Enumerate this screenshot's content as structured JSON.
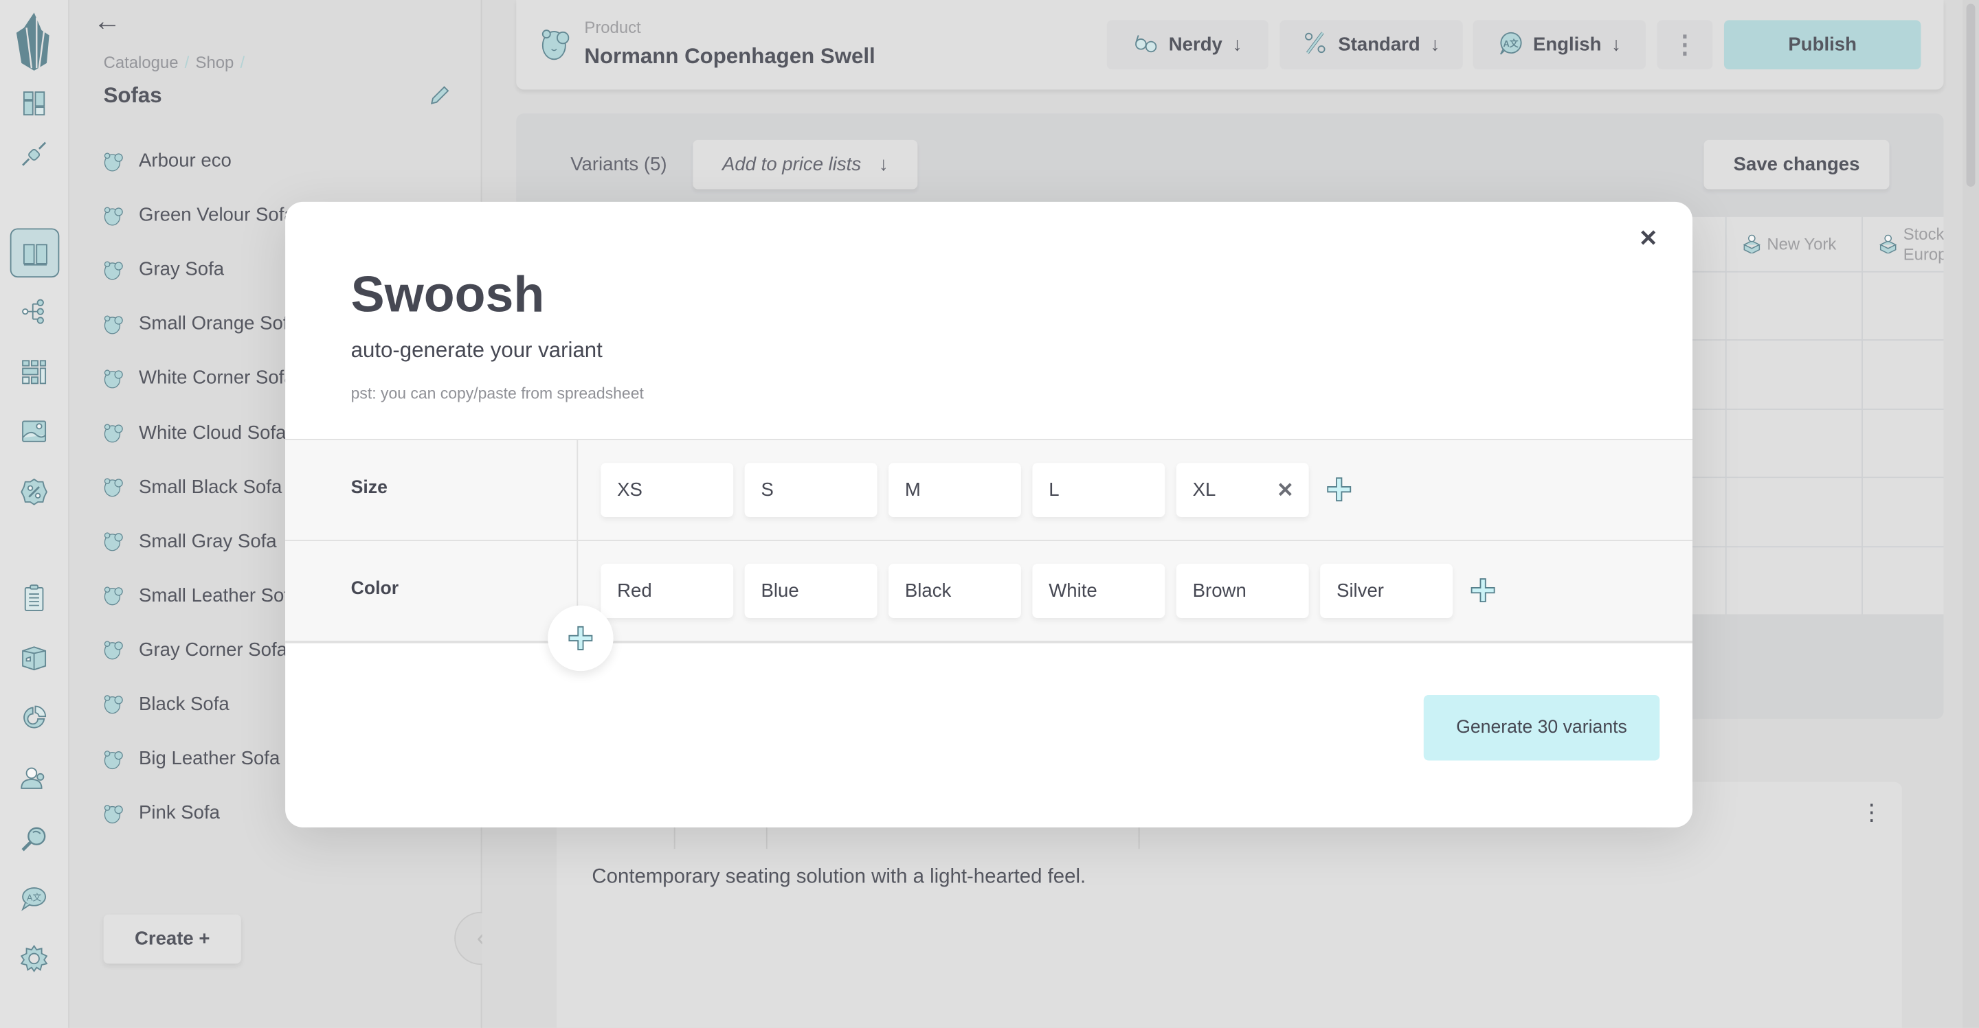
{
  "rail": {
    "logo": "logo-icon",
    "items": [
      {
        "icon": "dashboard-icon",
        "active": false
      },
      {
        "icon": "plug-icon",
        "active": false
      },
      {
        "icon": "book-icon",
        "active": true
      },
      {
        "icon": "tree-icon",
        "active": false
      },
      {
        "icon": "grid-icon",
        "active": false
      },
      {
        "icon": "image-icon",
        "active": false
      },
      {
        "icon": "discount-icon",
        "active": false
      },
      {
        "icon": "clipboard-icon",
        "active": false
      },
      {
        "icon": "box-icon",
        "active": false
      },
      {
        "icon": "pie-chart-icon",
        "active": false
      },
      {
        "icon": "users-icon",
        "active": false
      },
      {
        "icon": "search-icon",
        "active": false
      },
      {
        "icon": "translate-icon",
        "active": false
      },
      {
        "icon": "settings-icon",
        "active": false
      }
    ]
  },
  "sidebar": {
    "breadcrumb": [
      "Catalogue",
      "Shop"
    ],
    "breadcrumb_sep": "/",
    "title": "Sofas",
    "items": [
      "Arbour eco",
      "Green Velour Sofa",
      "Gray Sofa",
      "Small Orange Sofa",
      "White Corner Sofa",
      "White Cloud Sofa",
      "Small Black Sofa",
      "Small Gray Sofa",
      "Small Leather Sofa",
      "Gray Corner Sofa",
      "Black Sofa",
      "Big Leather Sofa",
      "Pink Sofa"
    ],
    "create_label": "Create +",
    "collapse_glyph": "‹",
    "back_glyph": "←"
  },
  "header": {
    "label": "Product",
    "name": "Normann Copenhagen Swell",
    "buttons": [
      {
        "label": "Nerdy",
        "icon": "glasses-icon",
        "arrow": "↓"
      },
      {
        "label": "Standard",
        "icon": "percent-icon",
        "arrow": "↓"
      },
      {
        "label": "English",
        "icon": "translate-icon",
        "arrow": "↓"
      }
    ],
    "more_glyph": "⋮",
    "publish_label": "Publish"
  },
  "variants": {
    "label": "Variants (5)",
    "price_lists_label": "Add to price lists",
    "price_lists_arrow": "↓",
    "save_label": "Save changes",
    "columns": [
      "New York",
      "Stock Europe"
    ]
  },
  "description": {
    "text": "Contemporary seating solution with a light-hearted feel.",
    "more_glyph": "⋮"
  },
  "modal": {
    "close_glyph": "✕",
    "title": "Swoosh",
    "subtitle": "auto-generate your variant",
    "hint": "pst: you can copy/paste from spreadsheet",
    "attributes": [
      {
        "name": "Size",
        "values": [
          "XS",
          "S",
          "M",
          "L",
          "XL"
        ],
        "removable_index": 4
      },
      {
        "name": "Color",
        "values": [
          "Red",
          "Blue",
          "Black",
          "White",
          "Brown",
          "Silver"
        ]
      }
    ],
    "remove_glyph": "✕",
    "generate_label": "Generate 30 variants"
  },
  "colors": {
    "accent": "#b2d9dc",
    "accent_light": "#cbf2f6",
    "icon_stroke": "#56808c",
    "text": "#464853"
  }
}
